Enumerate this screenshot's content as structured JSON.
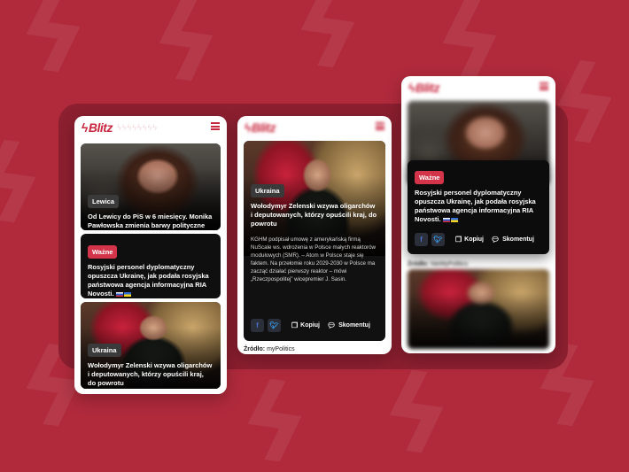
{
  "brand": {
    "logo": "Blitz",
    "accent": "#c8283f",
    "background": "#b02a3c"
  },
  "phone1": {
    "card1": {
      "badge": "Lewica",
      "headline": "Od Lewicy do PiS w 6 miesięcy. Monika Pawłowska zmienia barwy polityczne"
    },
    "card2": {
      "badge": "Ważne",
      "headline": "Rosyjski personel dyplomatyczny opuszcza Ukrainę, jak podała rosyjska państwowa agencja informacyjna RIA Novosti."
    },
    "card3": {
      "badge": "Ukraina",
      "headline": "Wołodymyr Zelenski wzywa oligarchów i deputowanych, którzy opuścili kraj, do powrotu"
    }
  },
  "phone2": {
    "card": {
      "badge": "Ukraina",
      "headline": "Wołodymyr Zelenski wzywa oligarchów i deputowanych, którzy opuścili kraj, do powrotu",
      "lead": "KGHM podpisał umowę z amerykańską firmą NuScale ws. wdrożenia w Polsce małych reaktorów modułowych (SMR). – Atom w Polsce staje się faktem. Na przełomie roku 2029-2030 w Polsce ma zacząć działać pierwszy reaktor – mówi „Rzeczpospolitej” wicepremier J. Sasin."
    },
    "share": {
      "facebook": "f",
      "twitter": "t",
      "copy": "Kopiuj",
      "comment": "Skomentuj"
    },
    "source_label": "Źródło:",
    "source_name": "myPolitics"
  },
  "phone3": {
    "card": {
      "badge": "Ważne",
      "headline": "Rosyjski personel dyplomatyczny opuszcza Ukrainę, jak podała rosyjska państwowa agencja informacyjna RIA Novosti."
    },
    "share": {
      "facebook": "f",
      "twitter": "t",
      "copy": "Kopiuj",
      "comment": "Skomentuj"
    },
    "source_label": "Źródło:",
    "source_name": "NieMyPolitics"
  }
}
